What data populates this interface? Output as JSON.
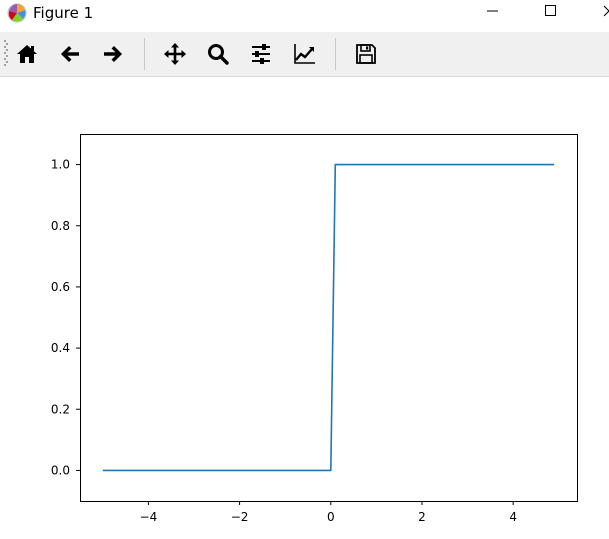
{
  "window": {
    "title": "Figure 1",
    "app_icon": "matplotlib-logo-icon",
    "controls": [
      "minimize-icon",
      "maximize-icon",
      "close-icon"
    ]
  },
  "toolbar": {
    "buttons": [
      {
        "name": "home",
        "icon": "home-icon"
      },
      {
        "name": "back",
        "icon": "arrow-left-icon"
      },
      {
        "name": "forward",
        "icon": "arrow-right-icon"
      },
      {
        "name": "pan",
        "icon": "move-arrows-icon"
      },
      {
        "name": "zoom",
        "icon": "magnifier-icon"
      },
      {
        "name": "configure-subplots",
        "icon": "sliders-icon"
      },
      {
        "name": "edit-axis",
        "icon": "line-chart-icon"
      },
      {
        "name": "save",
        "icon": "floppy-disk-icon"
      }
    ]
  },
  "chart_data": {
    "type": "line",
    "title": "",
    "xlabel": "",
    "ylabel": "",
    "x": [
      -5.0,
      0.0,
      0.1,
      4.9
    ],
    "series": [
      {
        "values": [
          0,
          0,
          1,
          1
        ],
        "color": "#1f77b4"
      }
    ],
    "xlim": [
      -5.5,
      5.4
    ],
    "ylim": [
      -0.1,
      1.1
    ],
    "xticks": [
      -4,
      -2,
      0,
      2,
      4
    ],
    "xtick_labels": [
      "−4",
      "−2",
      "0",
      "2",
      "4"
    ],
    "yticks": [
      0.0,
      0.2,
      0.4,
      0.6,
      0.8,
      1.0
    ],
    "ytick_labels": [
      "0.0",
      "0.2",
      "0.4",
      "0.6",
      "0.8",
      "1.0"
    ],
    "grid": false,
    "legend": false
  }
}
